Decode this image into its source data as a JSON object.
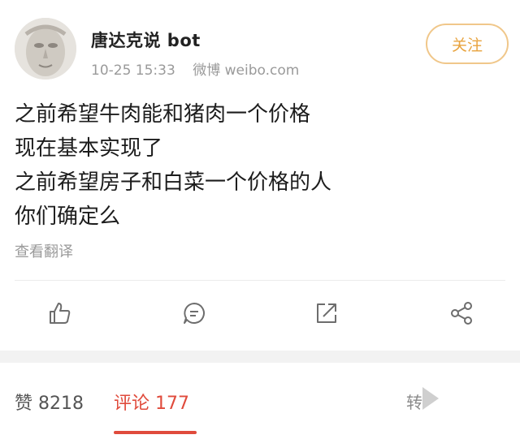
{
  "post": {
    "username": "唐达克说 bot",
    "time": "10-25 15:33",
    "source": "微博 weibo.com",
    "follow_label": "关注",
    "lines": [
      "之前希望牛肉能和猪肉一个价格",
      "现在基本实现了",
      "之前希望房子和白菜一个价格的人",
      "你们确定么"
    ],
    "translate_label": "查看翻译"
  },
  "actions": {
    "icons": [
      "like-icon",
      "comment-icon",
      "repost-icon",
      "share-icon"
    ]
  },
  "tabs": {
    "likes": "赞 8218",
    "comments": "评论 177",
    "more": "转"
  },
  "colors": {
    "accent_orange": "#e8a33e",
    "follow_border": "#f0c78a",
    "active_tab_red": "#e04b3c",
    "muted_gray": "#9a9a9a"
  }
}
